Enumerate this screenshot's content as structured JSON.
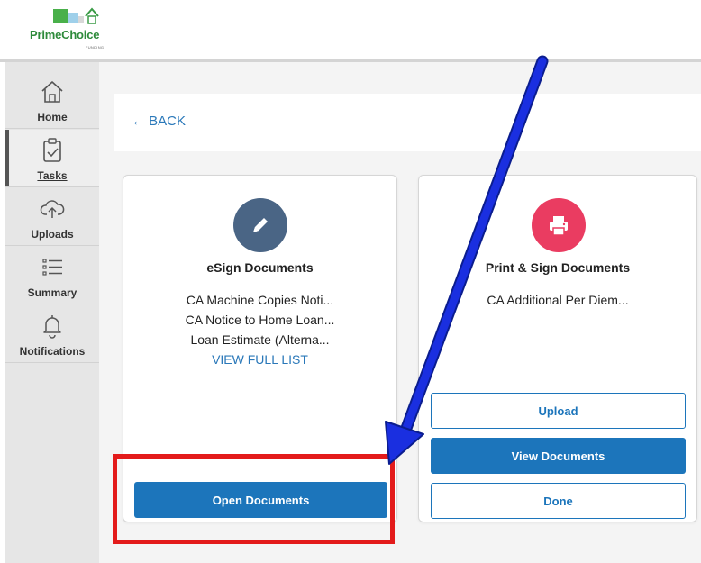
{
  "brand": {
    "name": "PrimeChoice",
    "sub": "FUNDING",
    "colors": {
      "green": "#2d8a3a",
      "accent": "#1c75bb"
    }
  },
  "sidebar": {
    "items": [
      {
        "label": "Home",
        "icon": "home-icon"
      },
      {
        "label": "Tasks",
        "icon": "clipboard-check-icon",
        "active": true
      },
      {
        "label": "Uploads",
        "icon": "cloud-upload-icon"
      },
      {
        "label": "Summary",
        "icon": "list-icon"
      },
      {
        "label": "Notifications",
        "icon": "bell-icon"
      }
    ]
  },
  "topbar": {
    "back_label": "BACK"
  },
  "cards": {
    "esign": {
      "title": "eSign Documents",
      "icon": "pencil-icon",
      "icon_color": "#4a6585",
      "documents": [
        "CA Machine Copies Noti...",
        "CA Notice to Home Loan...",
        "Loan Estimate (Alterna..."
      ],
      "view_full_list": "VIEW FULL LIST",
      "button_label": "Open Documents"
    },
    "print": {
      "title": "Print & Sign Documents",
      "icon": "printer-icon",
      "icon_color": "#ea3c61",
      "documents": [
        "CA Additional Per Diem..."
      ],
      "upload_label": "Upload",
      "view_label": "View Documents",
      "done_label": "Done"
    }
  },
  "annotations": {
    "highlight_color": "#e31b1b",
    "arrow_color": "#1a2fe0"
  }
}
